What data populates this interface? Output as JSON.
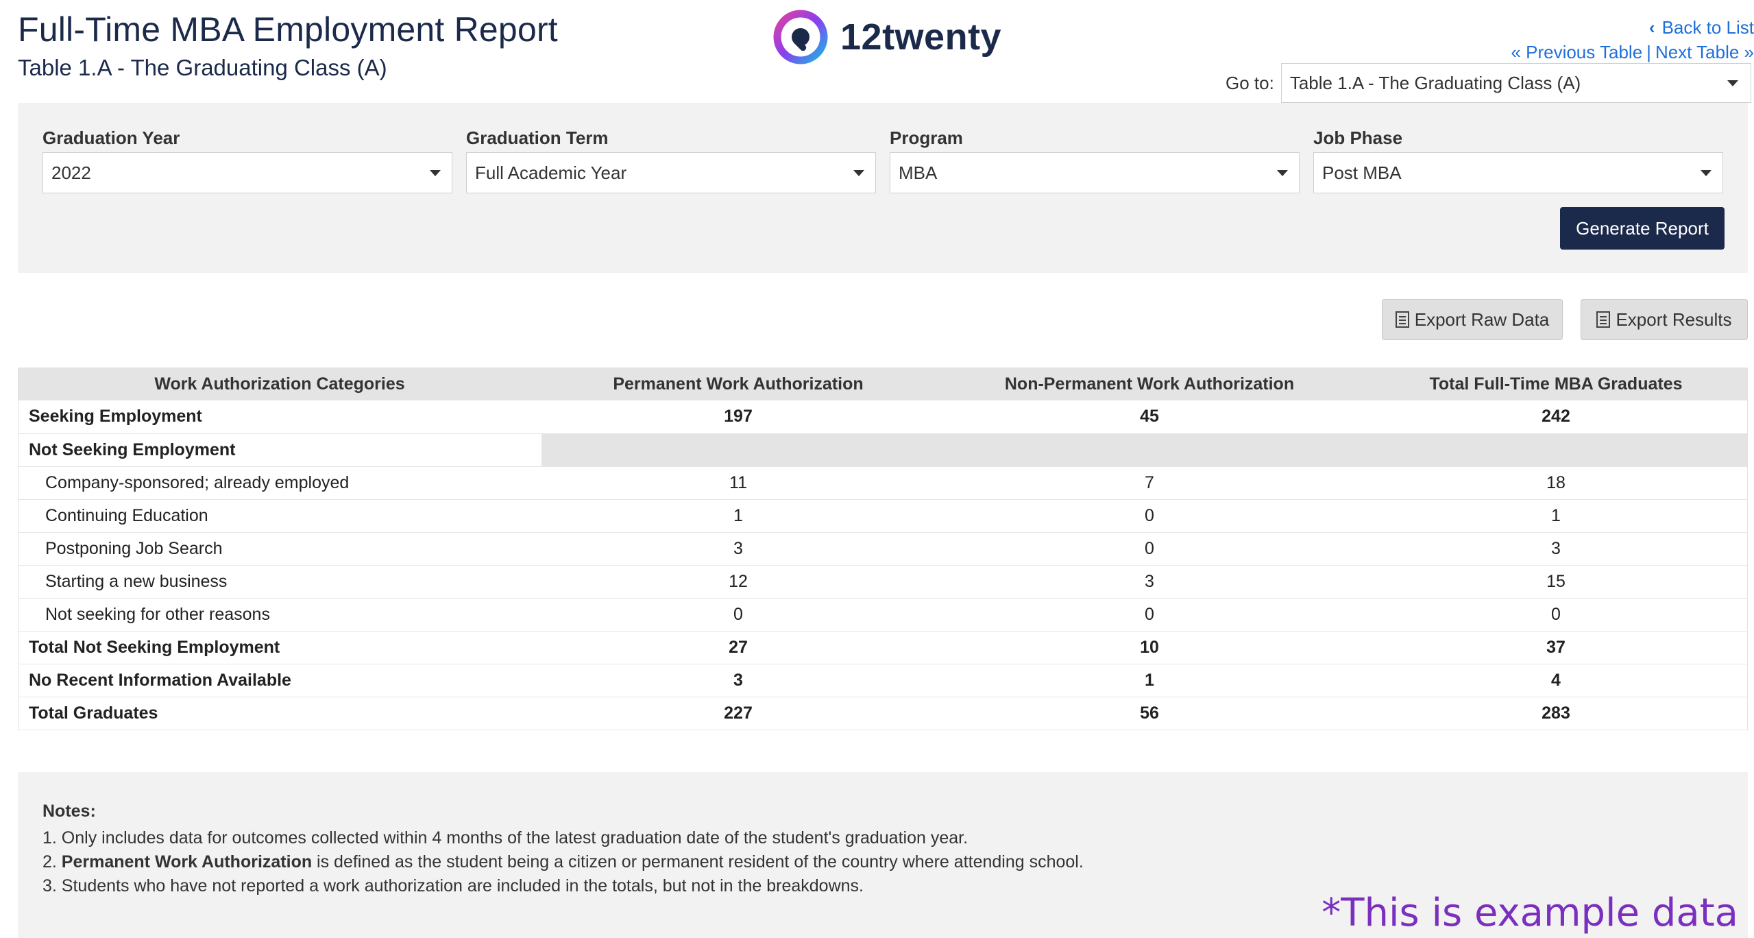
{
  "header": {
    "title": "Full-Time MBA Employment Report",
    "subtitle": "Table 1.A - The Graduating Class (A)",
    "logo_text": "12twenty"
  },
  "nav": {
    "back_label": "Back to List",
    "back_icon": "chevron-left-icon",
    "previous_label": "« Previous Table",
    "separator": "|",
    "next_label": "Next Table »",
    "goto_label": "Go to:",
    "goto_value": "Table 1.A - The Graduating Class (A)"
  },
  "filters": [
    {
      "label": "Graduation Year",
      "value": "2022"
    },
    {
      "label": "Graduation Term",
      "value": "Full Academic Year"
    },
    {
      "label": "Program",
      "value": "MBA"
    },
    {
      "label": "Job Phase",
      "value": "Post MBA"
    }
  ],
  "buttons": {
    "generate": "Generate Report",
    "export_raw": "Export Raw Data",
    "export_results": "Export Results"
  },
  "table": {
    "headers": [
      "Work Authorization Categories",
      "Permanent Work Authorization",
      "Non-Permanent Work Authorization",
      "Total Full-Time MBA Graduates"
    ],
    "rows": [
      {
        "label": "Seeking Employment",
        "values": [
          "197",
          "45",
          "242"
        ],
        "bold": true
      },
      {
        "label": "Not Seeking Employment",
        "values": [
          "",
          "",
          ""
        ],
        "bold": true,
        "section": true
      },
      {
        "label": "Company-sponsored; already employed",
        "values": [
          "11",
          "7",
          "18"
        ],
        "sub": true
      },
      {
        "label": "Continuing Education",
        "values": [
          "1",
          "0",
          "1"
        ],
        "sub": true
      },
      {
        "label": "Postponing Job Search",
        "values": [
          "3",
          "0",
          "3"
        ],
        "sub": true
      },
      {
        "label": "Starting a new business",
        "values": [
          "12",
          "3",
          "15"
        ],
        "sub": true
      },
      {
        "label": "Not seeking for other reasons",
        "values": [
          "0",
          "0",
          "0"
        ],
        "sub": true
      },
      {
        "label": "Total Not Seeking Employment",
        "values": [
          "27",
          "10",
          "37"
        ],
        "bold": true
      },
      {
        "label": "No Recent Information Available",
        "values": [
          "3",
          "1",
          "4"
        ],
        "bold": true
      },
      {
        "label": "Total Graduates",
        "values": [
          "227",
          "56",
          "283"
        ],
        "bold": true
      }
    ]
  },
  "notes": {
    "title": "Notes:",
    "line1": "1. Only includes data for outcomes collected within 4 months of the latest graduation date of the student's graduation year.",
    "line2_prefix": "2. ",
    "line2_bold": "Permanent Work Authorization",
    "line2_rest": " is defined as the student being a citizen or permanent resident of the country where attending school.",
    "line3": "3. Students who have not reported a work authorization are included in the totals, but not in the breakdowns."
  },
  "watermark": "*This is example data",
  "colors": {
    "brand_navy": "#1b2a4a",
    "link_blue": "#1e6fd9",
    "watermark_purple": "#7b2fbf"
  }
}
